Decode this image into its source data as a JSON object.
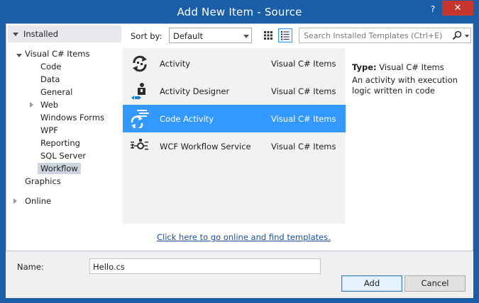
{
  "window": {
    "title": "Add New Item - Source",
    "help_glyph": "?",
    "close_glyph": "✕"
  },
  "tree": {
    "header": "Installed",
    "root": "Visual C# Items",
    "children": [
      "Code",
      "Data",
      "General",
      "Web",
      "Windows Forms",
      "WPF",
      "Reporting",
      "SQL Server",
      "Workflow"
    ],
    "selected": "Workflow",
    "graphics": "Graphics",
    "online": "Online"
  },
  "toolbar": {
    "sort_label": "Sort by:",
    "sort_value": "Default",
    "search_placeholder": "Search Installed Templates (Ctrl+E)"
  },
  "templates": [
    {
      "name": "Activity",
      "category": "Visual C# Items",
      "icon": "activity-icon",
      "selected": false
    },
    {
      "name": "Activity Designer",
      "category": "Visual C# Items",
      "icon": "activity-designer-icon",
      "selected": false
    },
    {
      "name": "Code Activity",
      "category": "Visual C# Items",
      "icon": "code-activity-icon",
      "selected": true
    },
    {
      "name": "WCF Workflow Service",
      "category": "Visual C# Items",
      "icon": "wcf-workflow-service-icon",
      "selected": false
    }
  ],
  "online_link": "Click here to go online and find templates.",
  "details": {
    "type_key": "Type:",
    "type_value": "Visual C# Items",
    "description": "An activity with execution logic written in code"
  },
  "bottom": {
    "name_label": "Name:",
    "name_value": "Hello.cs",
    "add_label": "Add",
    "cancel_label": "Cancel"
  },
  "colors": {
    "titlebar": "#1b5ea8",
    "close": "#c7352f",
    "selection": "#3399ff",
    "link": "#1c4f9c"
  }
}
